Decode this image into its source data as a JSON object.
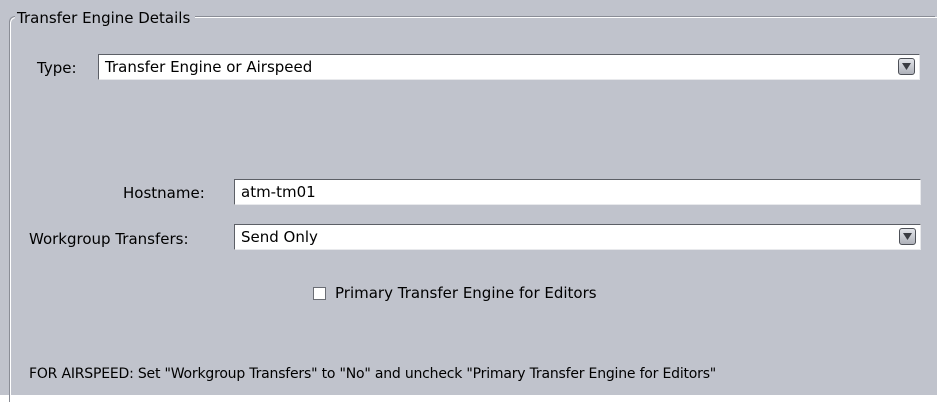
{
  "panel": {
    "legend": "Transfer Engine Details"
  },
  "type_field": {
    "label": "Type:",
    "value": "Transfer Engine or Airspeed"
  },
  "hostname_field": {
    "label": "Hostname:",
    "value": "atm-tm01"
  },
  "workgroup_field": {
    "label": "Workgroup Transfers:",
    "value": "Send Only"
  },
  "primary_checkbox": {
    "label": "Primary Transfer Engine for Editors",
    "checked": false
  },
  "note": {
    "text": "FOR AIRSPEED: Set \"Workgroup Transfers\" to \"No\" and uncheck \"Primary Transfer Engine for Editors\""
  },
  "icons": {
    "combo_arrow": "chevron-down-icon"
  },
  "colors": {
    "panel_background": "#c0c3cc",
    "field_background": "#ffffff"
  }
}
